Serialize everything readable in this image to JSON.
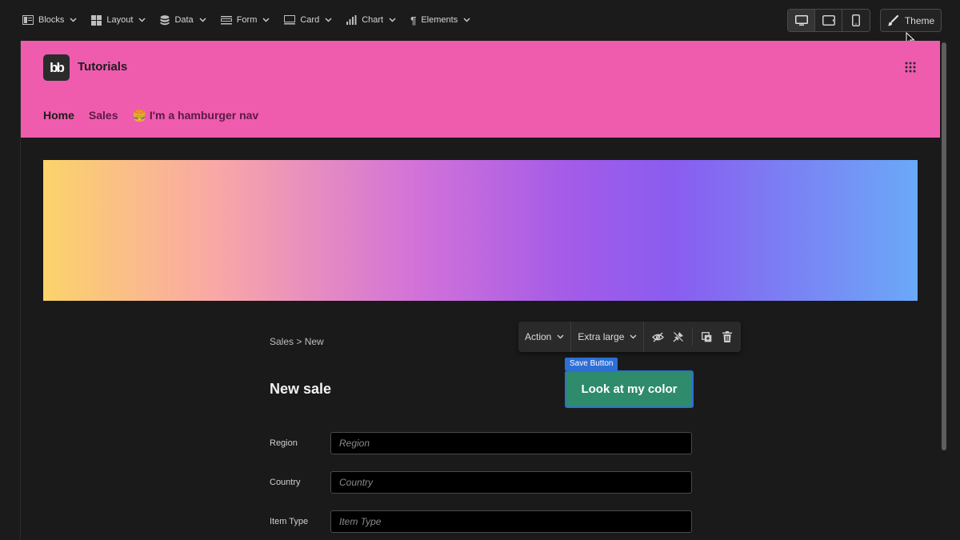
{
  "toolbar": {
    "items": [
      {
        "label": "Blocks",
        "icon": "blocks-icon"
      },
      {
        "label": "Layout",
        "icon": "layout-icon"
      },
      {
        "label": "Data",
        "icon": "data-icon"
      },
      {
        "label": "Form",
        "icon": "form-icon"
      },
      {
        "label": "Card",
        "icon": "card-icon"
      },
      {
        "label": "Chart",
        "icon": "chart-icon"
      },
      {
        "label": "Elements",
        "icon": "paragraph-icon"
      }
    ],
    "devices": [
      "desktop-icon",
      "tablet-icon",
      "mobile-icon"
    ],
    "active_device": "desktop",
    "theme_label": "Theme"
  },
  "app": {
    "logo_text": "bb",
    "title": "Tutorials",
    "header_color": "#ef5cae",
    "nav": [
      {
        "label": "Home",
        "active": true
      },
      {
        "label": "Sales",
        "active": false
      },
      {
        "label": "🍔 I'm a hamburger nav",
        "active": false
      }
    ]
  },
  "page": {
    "breadcrumb": "Sales > New",
    "title": "New sale"
  },
  "component_toolbar": {
    "action_label": "Action",
    "size_label": "Extra large",
    "icons": [
      "hide-icon",
      "unpin-icon",
      "duplicate-icon",
      "delete-icon"
    ]
  },
  "selected_component": {
    "label": "Save Button",
    "button_text": "Look at my color",
    "button_color": "#2e8b6b",
    "selection_color": "#2d6fd6"
  },
  "form": {
    "fields": [
      {
        "label": "Region",
        "placeholder": "Region"
      },
      {
        "label": "Country",
        "placeholder": "Country"
      },
      {
        "label": "Item Type",
        "placeholder": "Item Type"
      }
    ]
  }
}
